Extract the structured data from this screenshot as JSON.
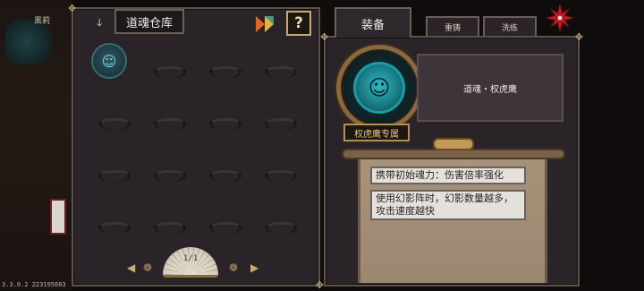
{
  "background": {
    "npc_name": "黑莉",
    "version": "3.3.0.2 223195603"
  },
  "storage": {
    "title": "道魂仓库",
    "help_label": "?",
    "page": "1/1",
    "slots": [
      {
        "filled": true,
        "icon": "soul-mask-icon"
      },
      {
        "filled": false
      },
      {
        "filled": false
      },
      {
        "filled": false
      },
      {
        "filled": false
      },
      {
        "filled": false
      },
      {
        "filled": false
      },
      {
        "filled": false
      },
      {
        "filled": false
      },
      {
        "filled": false
      },
      {
        "filled": false
      },
      {
        "filled": false
      },
      {
        "filled": false
      },
      {
        "filled": false
      },
      {
        "filled": false
      },
      {
        "filled": false
      }
    ]
  },
  "tabs": [
    {
      "label": "装备",
      "active": true
    },
    {
      "label": "重铸",
      "active": false
    },
    {
      "label": "洗练",
      "active": false
    }
  ],
  "detail": {
    "name": "道魂・权虎鹰",
    "exclusive_tag": "权虎鹰专属",
    "effects": [
      "携带初始魂力：伤害倍率强化",
      "使用幻影阵时，幻影数量越多，攻击速度越快"
    ]
  },
  "colors": {
    "accent_gold": "#c9a86b",
    "soul_teal": "#2fb8c1",
    "close_red": "#d41a24"
  }
}
